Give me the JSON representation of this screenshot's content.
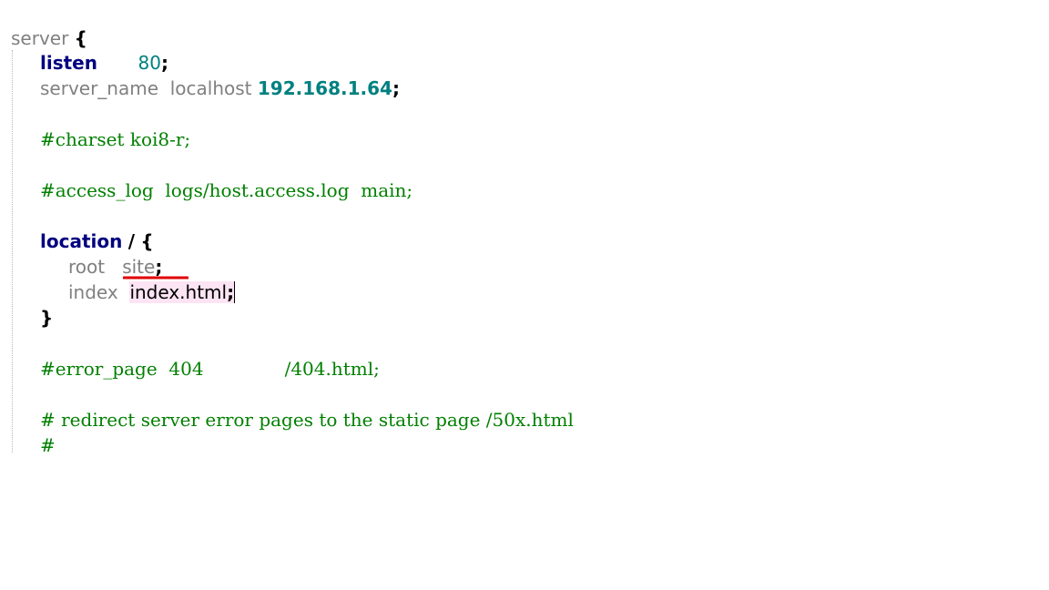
{
  "code": {
    "line1": {
      "keyword": "server",
      "brace": "{"
    },
    "line2": {
      "keyword": "listen",
      "spacing": "       ",
      "value": "80",
      "semicolon": ";"
    },
    "line3": {
      "keyword": "server_name",
      "spacing": "  ",
      "host": "localhost",
      "ip": "192.168.1.64",
      "semicolon": ";"
    },
    "line4": {
      "comment": "#charset koi8-r;"
    },
    "line5": {
      "comment": "#access_log  logs/host.access.log  main;"
    },
    "line6": {
      "keyword": "location",
      "slash": "/",
      "brace": "{"
    },
    "line7": {
      "keyword": "root",
      "value": "site",
      "semicolon": ";"
    },
    "line8": {
      "keyword": "index",
      "value": "index.html",
      "semicolon": ";"
    },
    "line9": {
      "brace": "}"
    },
    "line10": {
      "comment": "#error_page  404              /404.html;"
    },
    "line11": {
      "comment": "# redirect server error pages to the static page /50x.html"
    },
    "line12": {
      "comment": "#"
    }
  },
  "colors": {
    "keyword": "#000080",
    "plain": "#808080",
    "number": "#008080",
    "comment": "#008000",
    "highlight": "#fce4f4",
    "error_underline": "#e00000"
  }
}
